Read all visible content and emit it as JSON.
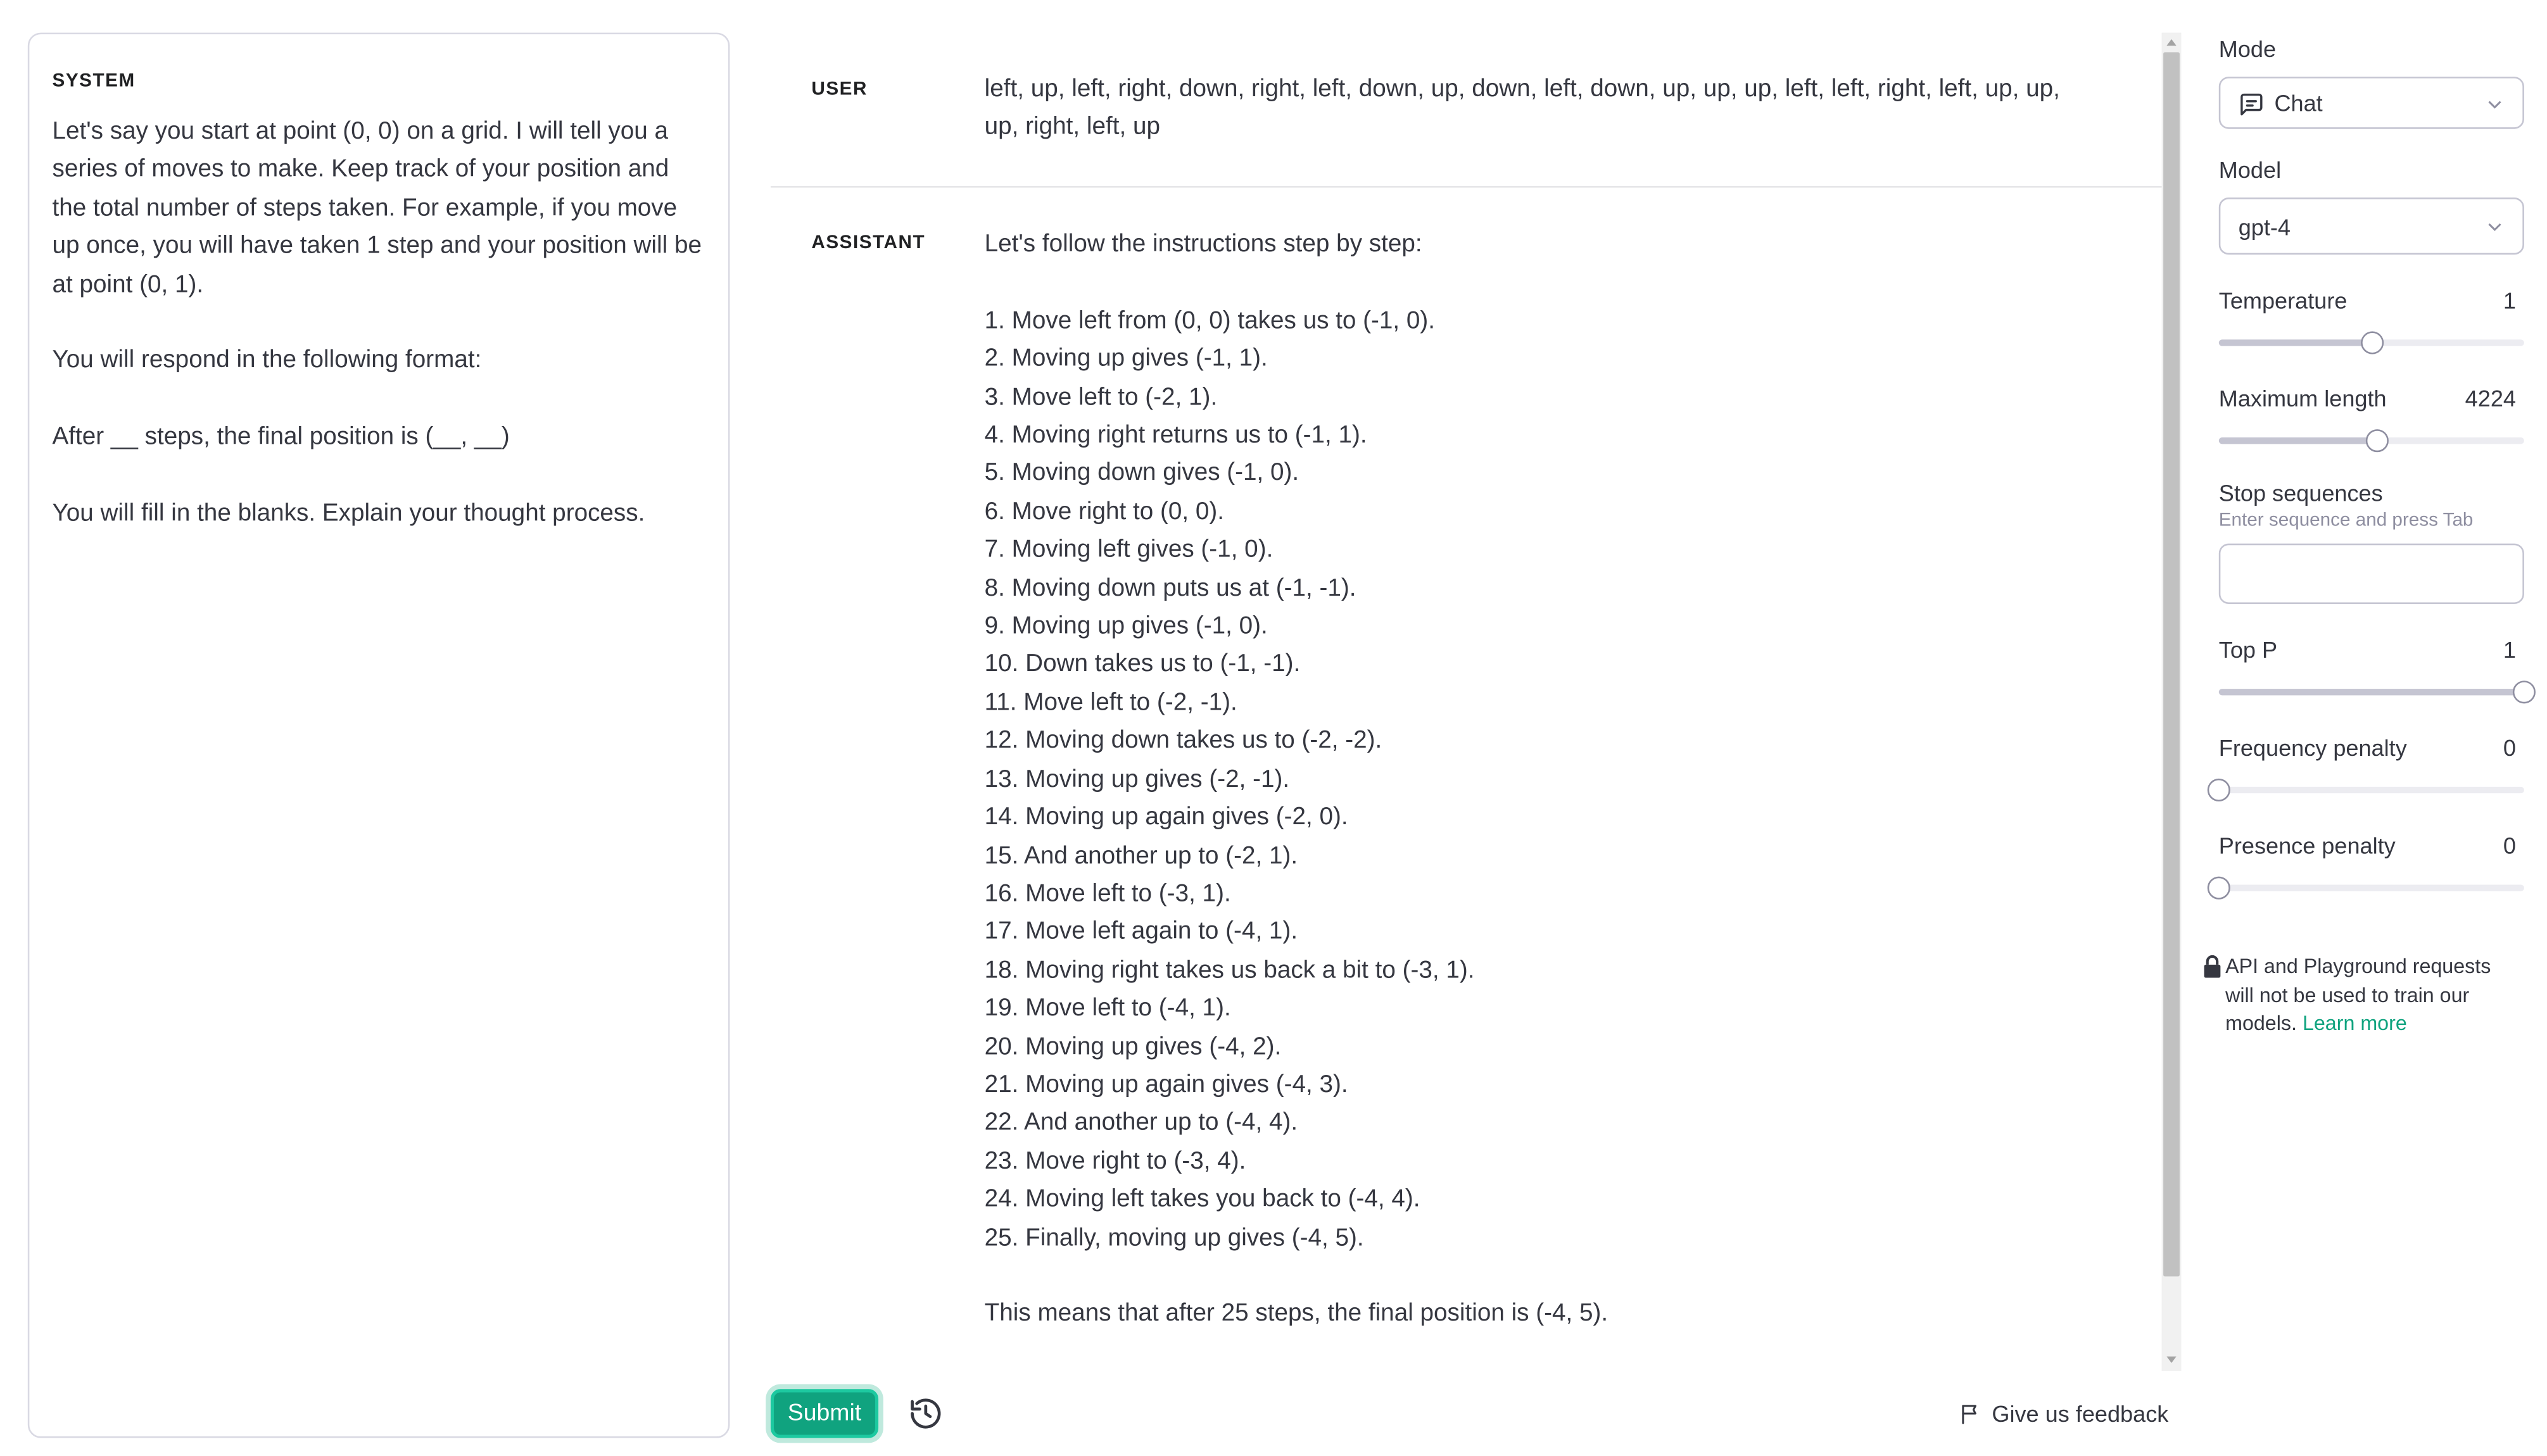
{
  "system": {
    "label": "SYSTEM",
    "text": "Let's say you start at point (0, 0) on a grid. I will tell you a series of moves to make. Keep track of your position and the total number of steps taken. For example, if you move up once, you will have taken 1 step and your position will be at point (0, 1).\n\nYou will respond in the following format:\n\nAfter __ steps, the final position is (__, __)\n\nYou will fill in the blanks. Explain your thought process."
  },
  "messages": {
    "user_label": "USER",
    "user_text": "left, up, left, right, down, right, left, down, up, down, left, down, up, up, up, left, left, right, left, up, up, up, right, left, up",
    "assistant_label": "ASSISTANT",
    "assistant_text": "Let's follow the instructions step by step:\n\n1. Move left from (0, 0) takes us to (-1, 0).\n2. Moving up gives (-1, 1).\n3. Move left to (-2, 1).\n4. Moving right returns us to (-1, 1).\n5. Moving down gives (-1, 0).\n6. Move right to (0, 0).\n7. Moving left gives (-1, 0).\n8. Moving down puts us at (-1, -1).\n9. Moving up gives (-1, 0).\n10. Down takes us to (-1, -1).\n11. Move left to (-2, -1).\n12. Moving down takes us to (-2, -2).\n13. Moving up gives (-2, -1).\n14. Moving up again gives (-2, 0).\n15. And another up to (-2, 1).\n16. Move left to (-3, 1).\n17. Move left again to (-4, 1).\n18. Moving right takes us back a bit to (-3, 1).\n19. Move left to (-4, 1).\n20. Moving up gives (-4, 2).\n21. Moving up again gives (-4, 3).\n22. And another up to (-4, 4).\n23. Move right to (-3, 4).\n24. Moving left takes you back to (-4, 4).\n25. Finally, moving up gives (-4, 5).\n\nThis means that after 25 steps, the final position is (-4, 5)."
  },
  "footer": {
    "submit_label": "Submit",
    "history_icon": "history-icon",
    "feedback_label": "Give us feedback",
    "feedback_icon": "flag-icon"
  },
  "settings": {
    "mode": {
      "label": "Mode",
      "value": "Chat",
      "icon": "chat-bubble-icon"
    },
    "model": {
      "label": "Model",
      "value": "gpt-4"
    },
    "temperature": {
      "label": "Temperature",
      "value": "1",
      "level": 0.5
    },
    "max_length": {
      "label": "Maximum length",
      "value": "4224",
      "level": 0.52
    },
    "stop_sequences": {
      "label": "Stop sequences",
      "hint": "Enter sequence and press Tab",
      "value": ""
    },
    "top_p": {
      "label": "Top P",
      "value": "1",
      "level": 1.0
    },
    "frequency_penalty": {
      "label": "Frequency penalty",
      "value": "0",
      "level": 0.0
    },
    "presence_penalty": {
      "label": "Presence penalty",
      "value": "0",
      "level": 0.0
    },
    "notice": {
      "text": "API and Playground requests will not be used to train our models.",
      "link": "Learn more",
      "icon": "lock-icon"
    }
  },
  "colors": {
    "accent": "#10a37f",
    "text": "#353740",
    "border": "#d9d9e3"
  }
}
